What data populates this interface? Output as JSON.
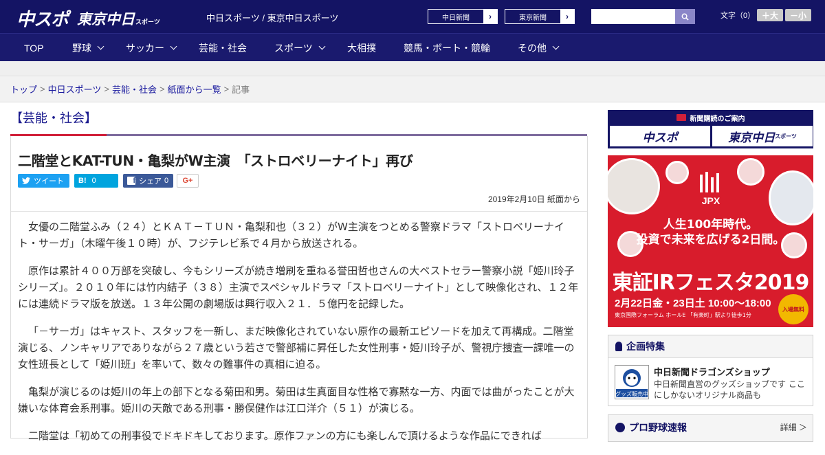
{
  "header": {
    "logo_chuspo": "中スポ",
    "logo_tokyo": "東京中日",
    "logo_tokyo_sub": "スポーツ",
    "site_names": "中日スポーツ / 東京中日スポーツ",
    "ext_links": [
      {
        "label": "中日新聞"
      },
      {
        "label": "東京新聞"
      }
    ],
    "search_placeholder": "",
    "fontsize_label": "文字（0）",
    "font_larger": "＋大",
    "font_smaller": "－小"
  },
  "nav": {
    "items": [
      {
        "label": "TOP"
      },
      {
        "label": "野球"
      },
      {
        "label": "サッカー"
      },
      {
        "label": "芸能・社会"
      },
      {
        "label": "スポーツ"
      },
      {
        "label": "大相撲"
      },
      {
        "label": "競馬・ボート・競輪"
      },
      {
        "label": "その他"
      }
    ]
  },
  "breadcrumb": {
    "items": [
      "トップ",
      "中日スポーツ",
      "芸能・社会",
      "紙面から一覧"
    ],
    "current": "記事",
    "separator": ">"
  },
  "section": {
    "title": "【芸能・社会】"
  },
  "article": {
    "headline": "二階堂とKAT-TUN・亀梨がW主演　「ストロベリーナイト」再び",
    "share": {
      "tweet_label": "ツイート",
      "hatena_label": "B!",
      "hatena_count": "0",
      "facebook_label": "シェア",
      "facebook_count": "0",
      "gplus_label": "G+"
    },
    "date": "2019年2月10日 紙面から",
    "paragraphs": [
      "女優の二階堂ふみ（２４）とＫＡＴ－ＴＵＮ・亀梨和也（３２）がW主演をつとめる警察ドラマ「ストロベリーナイト・サーガ」（木曜午後１０時）が、フジテレビ系で４月から放送される。",
      "原作は累計４００万部を突破し、今もシリーズが続き増刷を重ねる誉田哲也さんの大ベストセラー警察小説「姫川玲子シリーズ」。２０１０年には竹内結子（３８）主演でスペシャルドラマ「ストロベリーナイト」として映像化され、１２年には連続ドラマ版を放送。１３年公開の劇場版は興行収入２１．５億円を記録した。",
      "「－サーガ」はキャスト、スタッフを一新し、まだ映像化されていない原作の最新エピソードを加えて再構成。二階堂演じる、ノンキャリアでありながら２７歳という若さで警部補に昇任した女性刑事・姫川玲子が、警視庁捜査一課唯一の女性班長として「姫川班」を率いて、数々の難事件の真相に迫る。",
      "亀梨が演じるのは姫川の年上の部下となる菊田和男。菊田は生真面目な性格で寡黙な一方、内面では曲がったことが大嫌いな体育会系刑事。姫川の天敵である刑事・勝俣健作は江口洋介（５１）が演じる。",
      "二階堂は「初めての刑事役でドキドキしております。原作ファンの方にも楽しんで頂けるような作品にできれば"
    ]
  },
  "sidebar": {
    "subscribe": {
      "title": "新聞購読のご案内",
      "btn1": "中スポ",
      "btn2": "東京中日",
      "btn2_sub": "スポーツ"
    },
    "ad": {
      "brand": "JPX",
      "copy_line1": "人生100年時代。",
      "copy_line2": "投資で未来を広げる2日間。",
      "event": "東証IRフェスタ2019",
      "dates": "2月22日金・23日土 10:00～18:00",
      "venue": "東京国際フォーラム ホールE 「有楽町」駅より徒歩1分",
      "free_badge": "入場無料"
    },
    "feature": {
      "heading": "企画特集",
      "item_title": "中日新聞ドラゴンズショップ",
      "item_desc": "中日新聞直営のグッズショップです ここにしかないオリジナル商品も",
      "thumb_label": "グッズ販売中"
    },
    "baseball": {
      "heading": "プロ野球速報",
      "detail": "詳細 ＞"
    }
  },
  "colors": {
    "header_bg": "#141464",
    "nav_bg": "#1a1a6e",
    "accent_red": "#d1203a",
    "twitter": "#1da1f2",
    "hatena": "#00a4de",
    "facebook": "#3b5998",
    "ad_red": "#d81c2c"
  }
}
